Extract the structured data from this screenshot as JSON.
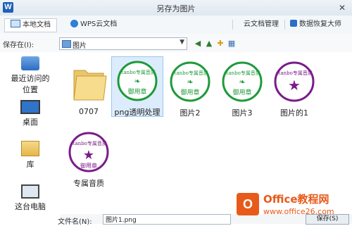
{
  "window": {
    "title": "另存为图片",
    "close_glyph": "✕",
    "app_logo": "W"
  },
  "tabs": [
    {
      "label": "本地文档",
      "icon": "computer-icon"
    },
    {
      "label": "WPS云文档",
      "icon": "cloud-icon"
    },
    {
      "label": "云文档管理",
      "icon": ""
    },
    {
      "label": "数据恢复大师",
      "icon": "recovery-icon"
    }
  ],
  "save_in": {
    "label": "保存在(I):",
    "value": "图片"
  },
  "sidebar": [
    {
      "label": "最近访问的位置",
      "line1": "最近访问的",
      "line2": "位置",
      "icon": "recent-icon"
    },
    {
      "label": "桌面",
      "icon": "desktop-icon"
    },
    {
      "label": "库",
      "icon": "library-icon"
    },
    {
      "label": "这台电脑",
      "icon": "computer-icon"
    }
  ],
  "files": [
    {
      "name": "0707",
      "type": "folder"
    },
    {
      "name": "png透明处理",
      "type": "seal-green",
      "selected": true
    },
    {
      "name": "图片2",
      "type": "seal-green"
    },
    {
      "name": "图片3",
      "type": "seal-green"
    },
    {
      "name": "图片的1",
      "type": "seal-purple"
    },
    {
      "name": "专属音质",
      "type": "seal-purple"
    }
  ],
  "seal": {
    "top_text": "stanbo专属音质",
    "center_text": "御用章",
    "green_color": "#1e9a3a",
    "purple_color": "#7a1c8a"
  },
  "filename": {
    "label": "文件名(N):",
    "value": "图片1.png"
  },
  "save_button": "保存(S)",
  "watermark": {
    "brand": "Office教程网",
    "url": "www.office26.com",
    "color": "#e85a1a"
  }
}
